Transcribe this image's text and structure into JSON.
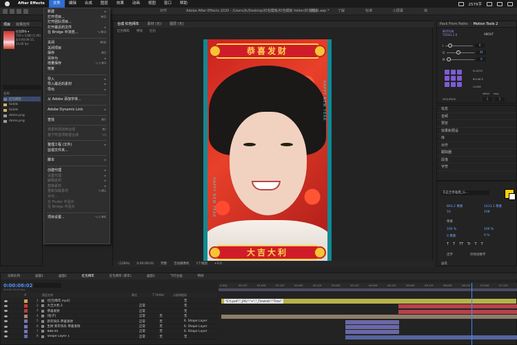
{
  "menubar": {
    "app": "After Effects",
    "items": [
      "文件",
      "编辑",
      "合成",
      "图层",
      "效果",
      "动画",
      "视图",
      "窗口",
      "帮助"
    ],
    "active_index": 0,
    "right": {
      "battery": "2579字",
      "time": ""
    }
  },
  "toolbar": {
    "snap_label": "对齐",
    "document_title": "Adobe After Effects 2020 - /Users/lk/Desktop/红包模板/红包模板 folder/红包模板.aep *",
    "workspaces": [
      "默认",
      "了解",
      "标准",
      "小屏幕",
      "库"
    ]
  },
  "project": {
    "tab": "项目",
    "tab2": "效果控件",
    "comp_name": "红包拜年 ▾",
    "meta_line1": "720 x 1280 (1.00)",
    "meta_line2": "Δ 0:00:09:15, 24.00 fps",
    "header": "名称",
    "items": [
      "红包拜年",
      "Solids",
      "Solids",
      "demo.png",
      "demo.png"
    ]
  },
  "file_menu": {
    "items": [
      {
        "label": "新建",
        "shortcut": "▸",
        "enabled": true
      },
      {
        "label": "打开项目...",
        "shortcut": "⌘O",
        "enabled": true
      },
      {
        "label": "打开团队项目...",
        "shortcut": "",
        "enabled": true
      },
      {
        "label": "打开最近的文件",
        "shortcut": "▸",
        "enabled": true
      },
      {
        "label": "在 Bridge 中浏览...",
        "shortcut": "⌥⌘O",
        "enabled": true
      },
      {
        "sep": true
      },
      {
        "label": "关闭",
        "shortcut": "⌘W",
        "enabled": true
      },
      {
        "label": "关闭项目",
        "shortcut": "",
        "enabled": true
      },
      {
        "label": "保存",
        "shortcut": "⌘S",
        "enabled": true
      },
      {
        "label": "另存为",
        "shortcut": "▸",
        "enabled": true
      },
      {
        "label": "增量保存",
        "shortcut": "⌥⇧⌘S",
        "enabled": true
      },
      {
        "label": "恢复",
        "shortcut": "",
        "enabled": true
      },
      {
        "sep": true
      },
      {
        "label": "导入",
        "shortcut": "▸",
        "enabled": true
      },
      {
        "label": "导入最近的素材",
        "shortcut": "▸",
        "enabled": true
      },
      {
        "label": "导出",
        "shortcut": "▸",
        "enabled": true
      },
      {
        "sep": true
      },
      {
        "label": "从 Adobe 添加字体...",
        "shortcut": "",
        "enabled": true
      },
      {
        "sep": true
      },
      {
        "label": "Adobe Dynamic Link",
        "shortcut": "▸",
        "enabled": true
      },
      {
        "sep": true
      },
      {
        "label": "查找",
        "shortcut": "⌘F",
        "enabled": true
      },
      {
        "sep": true
      },
      {
        "label": "将素材添加到合成",
        "shortcut": "⌘/",
        "enabled": false
      },
      {
        "label": "基于所选项新建合成",
        "shortcut": "⌥\\",
        "enabled": false
      },
      {
        "sep": true
      },
      {
        "label": "整理工程 (文件)",
        "shortcut": "▸",
        "enabled": true
      },
      {
        "label": "监视文件夹...",
        "shortcut": "",
        "enabled": true
      },
      {
        "sep": true
      },
      {
        "label": "脚本",
        "shortcut": "▸",
        "enabled": true
      },
      {
        "sep": true
      },
      {
        "label": "创建代理",
        "shortcut": "▸",
        "enabled": true
      },
      {
        "label": "设置代理",
        "shortcut": "▸",
        "enabled": false
      },
      {
        "label": "解释素材",
        "shortcut": "▸",
        "enabled": false
      },
      {
        "label": "替换素材",
        "shortcut": "▸",
        "enabled": false
      },
      {
        "label": "重新加载素材",
        "shortcut": "⌥⌘L",
        "enabled": false
      },
      {
        "label": "许可...",
        "shortcut": "",
        "enabled": false
      },
      {
        "label": "在 Finder 中显示",
        "shortcut": "",
        "enabled": false
      },
      {
        "label": "在 Bridge 中显示",
        "shortcut": "",
        "enabled": false
      },
      {
        "sep": true
      },
      {
        "label": "项目设置...",
        "shortcut": "⌥⇧⌘K",
        "enabled": true
      }
    ]
  },
  "viewer": {
    "tabs": [
      "合成 红包拜年",
      "素材 (无)",
      "图层 (无)"
    ],
    "sub_tabs": [
      "红包拜年",
      "特效",
      "红包"
    ],
    "top_banner": "恭喜发财",
    "bottom_banner": "大吉大利",
    "side_text": "HAPPY NEW YEAR",
    "status": [
      "(128%)",
      "完整",
      "活动摄像机",
      "1个视图",
      "+0.0",
      "0:00:06:02"
    ]
  },
  "motion_tools": {
    "tab1": "Pack From Paths",
    "tab2": "Motion Tools 2",
    "title_line1": "MOTION",
    "title_line2": "TOOLS 2.0",
    "about": "ABOUT",
    "sliders": [
      {
        "label": "I",
        "value": "0"
      },
      {
        "label": "O",
        "value": "34"
      },
      {
        "label": "M",
        "value": "0"
      }
    ],
    "labels": [
      "ELASTIC",
      "BOUNCE",
      "CLONE",
      "offset",
      "step",
      "SEQUENCE"
    ],
    "seq_values": [
      "1",
      "1"
    ]
  },
  "right_list": {
    "items": [
      "信息",
      "音频",
      "预览",
      "效果和预设",
      "库",
      "对齐",
      "跟踪器",
      "段落",
      "字符"
    ]
  },
  "character": {
    "title": "字符",
    "font": "方正兰亭准黑_G...",
    "size": "893.2 像素",
    "leading": "1413.1 像素",
    "tracking": "10",
    "kerning": "108",
    "stroke": "像素",
    "vscale": "100 %",
    "hscale": "100 %",
    "baseline": "0 像素",
    "tsume": "0 %",
    "faux_styles": [
      "T",
      "T",
      "TT",
      "Tr",
      "T",
      "T",
      "T",
      "T"
    ],
    "checkbox1": "连字",
    "checkbox2": "印地语数字",
    "footer": "画笔"
  },
  "timeline": {
    "tabs": [
      "渲染队列",
      "画面1",
      "画面2",
      "红包拜年",
      "红包拜年 (新年)",
      "画面3",
      "飞行主画",
      "特效"
    ],
    "active_tab": 3,
    "timecode": "0:00:06:02",
    "fps": "00146 (24.00 fps)",
    "columns": [
      "#",
      "图层名称",
      "模式",
      "T TrkMat",
      "父级和链接"
    ],
    "ruler": [
      "0:00s",
      "00:12f",
      "01:00f",
      "01:12f",
      "02:00f",
      "02:12f",
      "03:00f",
      "03:12f",
      "04:00f",
      "04:12f",
      "05:00f",
      "05:12f",
      "06:00f",
      "06:12f",
      "07:00f",
      "07:12f"
    ],
    "expression": "\"C:\\\\.psd\";\"_JPG;\":\"+\",\"_TimeInfo\":\"Time\"",
    "layers": [
      {
        "num": "1",
        "name": "[红包拜年.mp4]",
        "mode": "",
        "trk": "",
        "parent": "无",
        "color": "#d9a13c"
      },
      {
        "num": "2",
        "name": "大吉大利 2",
        "mode": "正常",
        "trk": "",
        "parent": "无",
        "color": "#c63b3b"
      },
      {
        "num": "3",
        "name": "恭喜发财",
        "mode": "正常",
        "trk": "",
        "parent": "无",
        "color": "#c63b3b"
      },
      {
        "num": "4",
        "name": "[粒子]",
        "mode": "正常",
        "trk": "无",
        "parent": "无",
        "color": "#a58b6b"
      },
      {
        "num": "5",
        "name": "新年快乐 恭喜发财",
        "mode": "正常",
        "trk": "无",
        "parent": "6. Shape Layer",
        "color": "#7874b6"
      },
      {
        "num": "6",
        "name": "生财 新年快乐 恭喜发财",
        "mode": "正常",
        "trk": "无",
        "parent": "6. Shape Layer",
        "color": "#7874b6"
      },
      {
        "num": "7",
        "name": "888.00",
        "mode": "正常",
        "trk": "无",
        "parent": "6. Shape Layer",
        "color": "#7874b6"
      },
      {
        "num": "8",
        "name": "Shape Layer 1",
        "mode": "正常",
        "trk": "无",
        "parent": "无",
        "color": "#5b6fb5"
      }
    ]
  }
}
